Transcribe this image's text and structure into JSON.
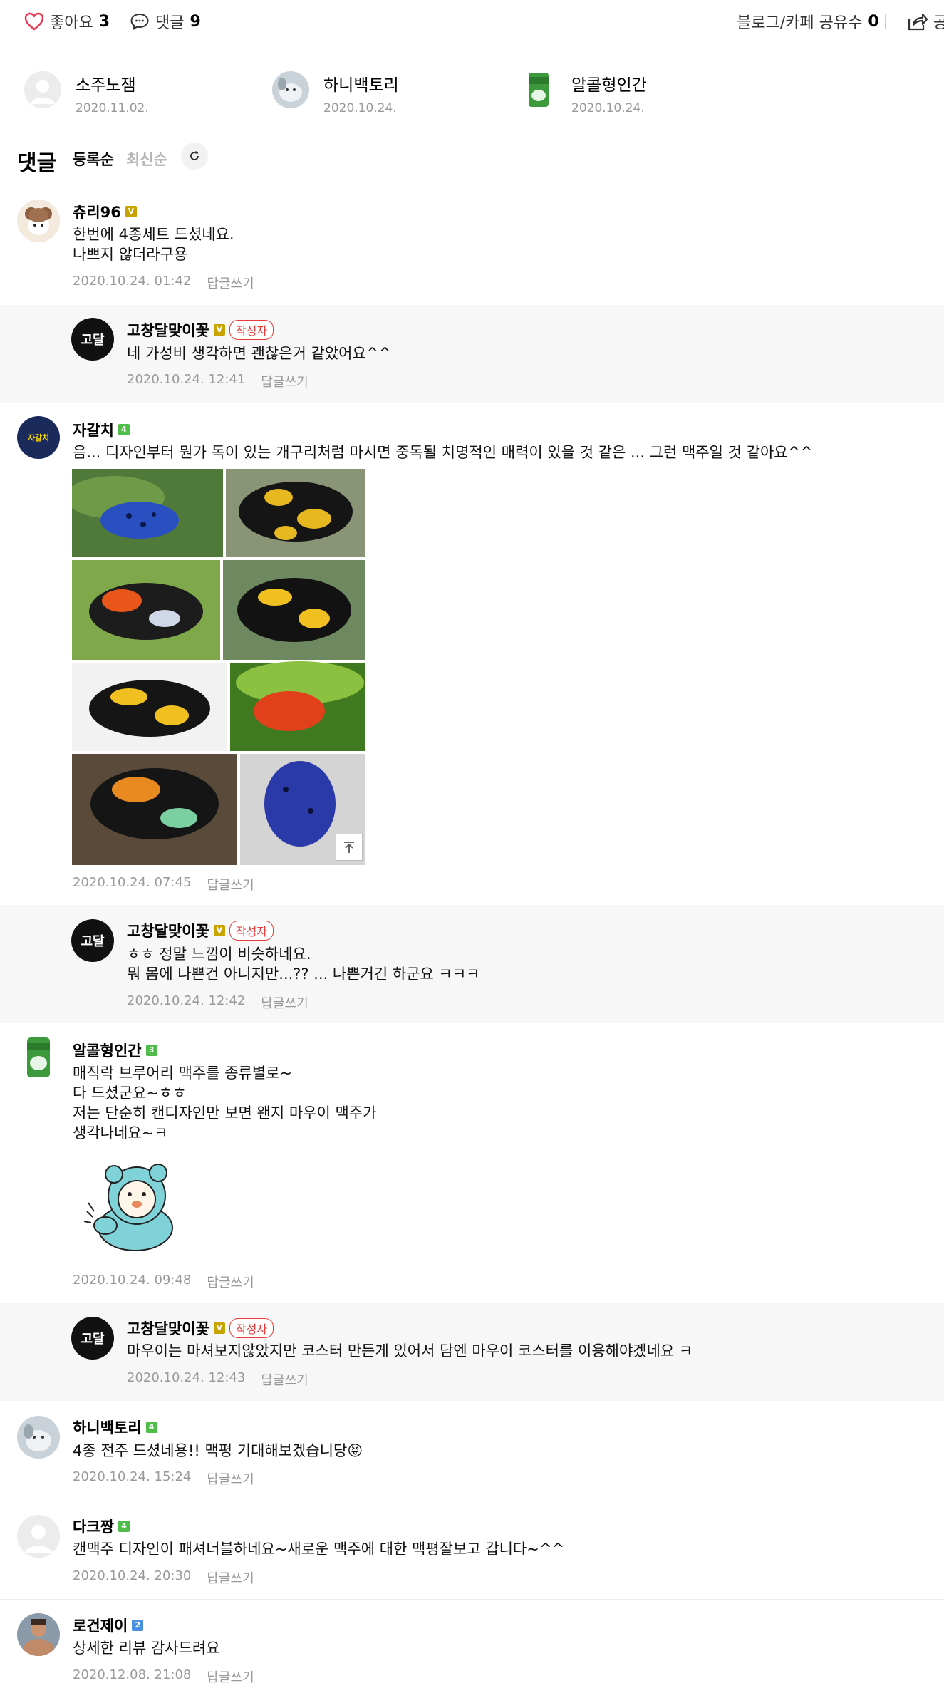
{
  "topbar": {
    "like_label": "좋아요",
    "like_count": "3",
    "comment_label": "댓글",
    "comment_count": "9",
    "share_label": "블로그/카페 공유수",
    "share_count": "0",
    "share_cut_label": "공"
  },
  "likers": [
    {
      "name": "소주노잼",
      "date": "2020.11.02."
    },
    {
      "name": "하니백토리",
      "date": "2020.10.24."
    },
    {
      "name": "알콜형인간",
      "date": "2020.10.24."
    }
  ],
  "comments_header": {
    "title": "댓글",
    "sort_registered": "등록순",
    "sort_latest": "최신순"
  },
  "reply_label": "답글쓰기",
  "author_tag": "작성자",
  "comments": [
    {
      "nick": "츄리96",
      "text": "한번에 4종세트 드셨네요.\n나쁘지 않더라구용",
      "date": "2020.10.24. 01:42"
    },
    {
      "nick": "고창달맞이꽃",
      "text": "네 가성비 생각하면 괜찮은거 같았어요^^",
      "date": "2020.10.24. 12:41",
      "avatar_text": "고달"
    },
    {
      "nick": "자갈치",
      "level": "4",
      "text": "음... 디자인부터 뭔가 독이 있는 개구리처럼 마시면 중독될 치명적인 매력이 있을 것 같은 ... 그런 맥주일 것 같아요^^",
      "date": "2020.10.24. 07:45",
      "badge_text": "자갈치"
    },
    {
      "nick": "고창달맞이꽃",
      "text": "ㅎㅎ 정말 느낌이 비슷하네요.\n뭐 몸에 나쁜건 아니지만...?? ... 나쁜거긴 하군요 ㅋㅋㅋ",
      "date": "2020.10.24. 12:42",
      "avatar_text": "고달"
    },
    {
      "nick": "알콜형인간",
      "level": "3",
      "text": "매직락 브루어리 맥주를 종류별로~\n다 드셨군요~ㅎㅎ\n저는 단순히 캔디자인만 보면 왠지 마우이 맥주가\n생각나네요~ㅋ",
      "date": "2020.10.24. 09:48"
    },
    {
      "nick": "고창달맞이꽃",
      "text": "마우이는 마셔보지않았지만 코스터 만든게 있어서 담엔 마우이 코스터를 이용해야겠네요 ㅋ",
      "date": "2020.10.24. 12:43",
      "avatar_text": "고달"
    },
    {
      "nick": "하니백토리",
      "level": "4",
      "text": "4종 전주 드셨네용!! 맥평 기대해보겠습니당😝",
      "date": "2020.10.24. 15:24"
    },
    {
      "nick": "다크짱",
      "level": "4",
      "text": "캔맥주 디자인이 패셔너블하네요~새로운 맥주에 대한 맥평잘보고 갑니다~^^",
      "date": "2020.10.24. 20:30"
    },
    {
      "nick": "로건제이",
      "level": "2",
      "text": "상세한 리뷰 감사드려요",
      "date": "2020.12.08. 21:08"
    }
  ],
  "colors": {
    "heart": "#e8344e",
    "author_tag": "#e83c3c",
    "meta": "#999999",
    "reply_bg": "#f7f7f7"
  },
  "icons": [
    "heart-icon",
    "speech-bubble-icon",
    "share-icon",
    "refresh-icon",
    "to-top-icon",
    "level-badge-icon"
  ]
}
